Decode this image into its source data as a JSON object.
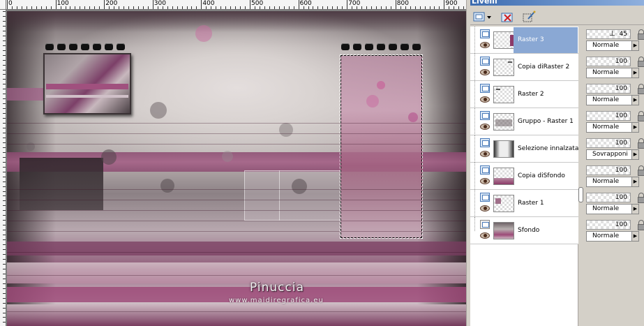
{
  "ruler": {
    "labels": [
      "0",
      "100",
      "200",
      "300",
      "400",
      "500",
      "600",
      "700",
      "800",
      "900"
    ]
  },
  "canvas": {
    "watermark_name": "Pinuccia",
    "watermark_url": "www.maidiregrafica.eu",
    "colors": {
      "magenta": "#8d4a72",
      "pink": "#c98aa8",
      "gray": "#b8b0b0",
      "dark": "#2a2426"
    }
  },
  "palette": {
    "title": "Livelli",
    "toolbar": {
      "new_layer_icon": "new-raster-layer-icon",
      "delete_icon": "delete-layer-icon",
      "edit_selection_icon": "edit-selection-icon"
    },
    "layers": [
      {
        "name": "Raster 3",
        "opacity": "45",
        "blend": "Normale",
        "selected": true
      },
      {
        "name": "Copia diRaster 2",
        "opacity": "100",
        "blend": "Normale",
        "selected": false
      },
      {
        "name": "Raster 2",
        "opacity": "100",
        "blend": "Normale",
        "selected": false
      },
      {
        "name": "Gruppo - Raster 1",
        "opacity": "100",
        "blend": "Normale",
        "selected": false
      },
      {
        "name": "Selezione innalzata",
        "opacity": "100",
        "blend": "Sovrapponi",
        "selected": false
      },
      {
        "name": "Copia diSfondo",
        "opacity": "100",
        "blend": "Normale",
        "selected": false
      },
      {
        "name": "Raster 1",
        "opacity": "100",
        "blend": "Normale",
        "selected": false
      },
      {
        "name": "Sfondo",
        "opacity": "100",
        "blend": "Normale",
        "selected": false
      }
    ]
  }
}
